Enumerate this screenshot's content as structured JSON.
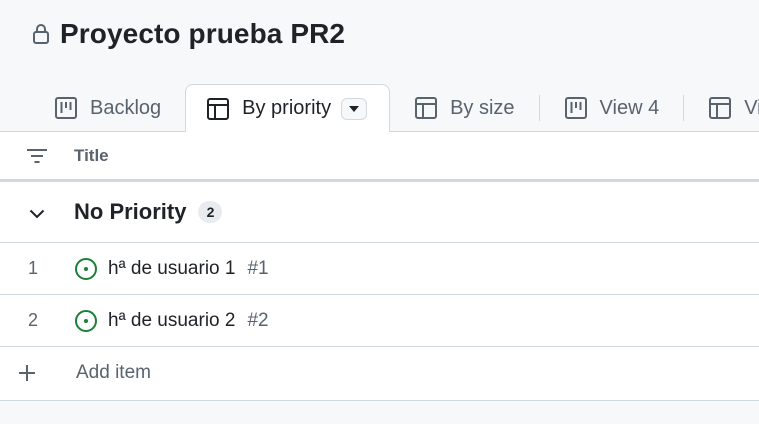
{
  "project": {
    "title": "Proyecto prueba PR2",
    "icon": "lock-icon"
  },
  "tabs": [
    {
      "label": "Backlog",
      "icon": "board-icon"
    },
    {
      "label": "By priority",
      "icon": "table-icon",
      "active": true
    },
    {
      "label": "By size",
      "icon": "table-icon"
    },
    {
      "label": "View 4",
      "icon": "board-icon"
    },
    {
      "label": "Vie",
      "icon": "table-icon"
    }
  ],
  "table": {
    "columns": {
      "title": "Title"
    },
    "group": {
      "name": "No Priority",
      "count": "2"
    },
    "items": [
      {
        "num": "1",
        "title": "hª de usuario 1",
        "ref": "#1",
        "status_icon": "issue-open-icon"
      },
      {
        "num": "2",
        "title": "hª de usuario 2",
        "ref": "#2",
        "status_icon": "issue-open-icon"
      }
    ],
    "add_item": "Add item"
  },
  "colors": {
    "open_issue": "#1a7f37",
    "border": "#d1d9e0",
    "muted": "#59636e"
  }
}
